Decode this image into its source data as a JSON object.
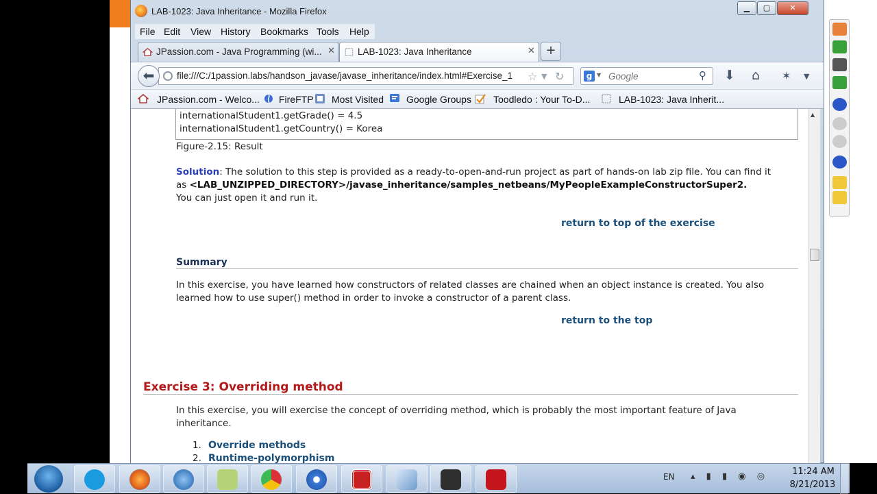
{
  "window": {
    "title": "LAB-1023: Java Inheritance - Mozilla Firefox",
    "controls": {
      "minimize": "▁",
      "maximize": "▢",
      "close": "✕"
    }
  },
  "menu": [
    "File",
    "Edit",
    "View",
    "History",
    "Bookmarks",
    "Tools",
    "Help"
  ],
  "tabs": [
    {
      "label": "JPassion.com - Java Programming (wi...",
      "close": "✕"
    },
    {
      "label": "LAB-1023: Java Inheritance",
      "close": "✕"
    }
  ],
  "new_tab": "+",
  "nav": {
    "url": "file:///C:/1passion.labs/handson_javase/javase_inheritance/index.html#Exercise_1",
    "search_placeholder": "Google",
    "search_engine": "g",
    "icons": [
      "star-icon",
      "dropdown-icon",
      "reload-icon",
      "download-icon",
      "home-icon",
      "addon-icon",
      "menu-icon"
    ]
  },
  "bookmarks": [
    "JPassion.com - Welco...",
    "FireFTP",
    "Most Visited",
    "Google Groups",
    "Toodledo : Your To-D...",
    "LAB-1023: Java Inherit..."
  ],
  "page": {
    "code_lines": [
      "internationalStudent1.getGrade() = 4.5",
      "internationalStudent1.getCountry() = Korea"
    ],
    "figure_caption": "Figure-2.15: Result",
    "solution_label": "Solution",
    "solution_text_1": ": The solution to this step is provided as a ready-to-open-and-run project as part of hands-on lab zip file. You can find it",
    "solution_as": "as ",
    "solution_path": "<LAB_UNZIPPED_DIRECTORY>/javase_inheritance/samples_netbeans/MyPeopleExampleConstructorSuper2.",
    "solution_text_2": "You can just open it and run it.",
    "return_exercise": "return to top of the exercise",
    "summary_heading": "Summary",
    "summary_text_1": "In this exercise,  you have learned how constructors of related classes are chained when an object instance is created.  You also",
    "summary_text_2": "learned how to use super() method in order to invoke a constructor of a parent class.",
    "return_top": "return to the top",
    "exercise3_heading": "Exercise 3: Overriding method",
    "exercise3_text_1": "In this exercise, you will exercise the concept of overriding method, which is probably the most important feature of Java",
    "exercise3_text_2": "inheritance.",
    "list": [
      {
        "num": "1.",
        "label": "Override methods"
      },
      {
        "num": "2.",
        "label": "Runtime-polymorphism"
      }
    ]
  },
  "taskbar": {
    "apps": [
      "skype",
      "firefox",
      "thunderbird",
      "notes",
      "chrome",
      "flower-app",
      "red-app",
      "virtualbox",
      "usb-app",
      "acrobat"
    ],
    "language": "EN",
    "tray": "▴ ▮ ▮ ◉ ◎",
    "time": "11:24 AM",
    "date": "8/21/2013"
  },
  "colors": {
    "accent_orange": "#f07e1c",
    "link_blue": "#1a4f7a",
    "solution_blue": "#2a3fb8",
    "heading_red": "#b31b1b"
  }
}
